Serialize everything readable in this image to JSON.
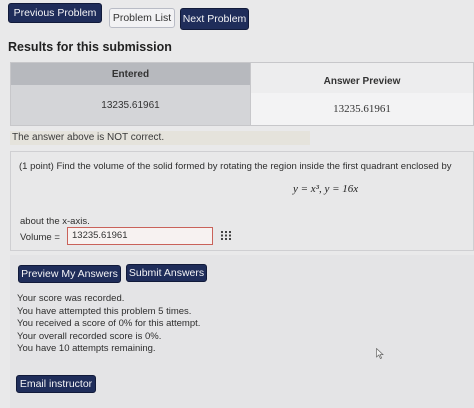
{
  "nav": {
    "previous_label": "Previous Problem",
    "list_label": "Problem List",
    "next_label": "Next Problem"
  },
  "results": {
    "title": "Results for this submission",
    "col_entered": "Entered",
    "col_preview": "Answer Preview",
    "entered_value": "13235.61961",
    "preview_value": "13235.61961",
    "status_note": "The answer above is NOT correct."
  },
  "problem": {
    "statement": "(1 point) Find the volume of the solid formed by rotating the region inside the first quadrant enclosed by",
    "equation": "y = x³,   y = 16x",
    "about_text": "about the x-axis.",
    "volume_label": "Volume =",
    "volume_value": "13235.61961",
    "grid_icon": "grid-icon"
  },
  "actions": {
    "preview_label": "Preview My Answers",
    "submit_label": "Submit Answers",
    "email_label": "Email instructor"
  },
  "feedback": {
    "line1": "Your score was recorded.",
    "line2": "You have attempted this problem 5 times.",
    "line3": "You received a score of 0% for this attempt.",
    "line4": "Your overall recorded score is 0%.",
    "line5": "You have 10 attempts remaining."
  },
  "colors": {
    "primary_button": "#1f2d5a",
    "error_border": "#c9625a",
    "background": "#e9e9ea"
  }
}
